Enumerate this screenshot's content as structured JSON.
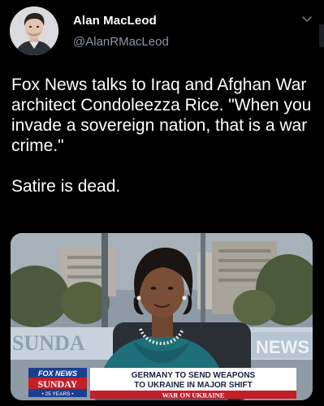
{
  "tweet": {
    "author_name": "Alan MacLeod",
    "author_handle": "@AlanRMacLeod",
    "text": "Fox News talks to Iraq and Afghan War architect Condoleezza Rice. \"When you invade a sovereign nation, that is a war crime.\"\n\nSatire is dead."
  },
  "icons": {
    "avatar": "avatar",
    "more": "chevron-down-icon"
  },
  "media": {
    "backdrop_word": "SUNDA",
    "backdrop_news": "NEWS",
    "logo_line1": "FOX NEWS",
    "logo_line2": "SUNDAY",
    "logo_line3": "• 25 YEARS •",
    "headline_line1": "GERMANY TO SEND WEAPONS",
    "headline_line2": "TO UKRAINE IN MAJOR SHIFT",
    "headline_tag": "WAR ON UKRAINE"
  },
  "colors": {
    "background": "#000000",
    "handle": "#8b98a5",
    "chyron_blue": "#1b3f8f",
    "chyron_red": "#c21f2a"
  }
}
